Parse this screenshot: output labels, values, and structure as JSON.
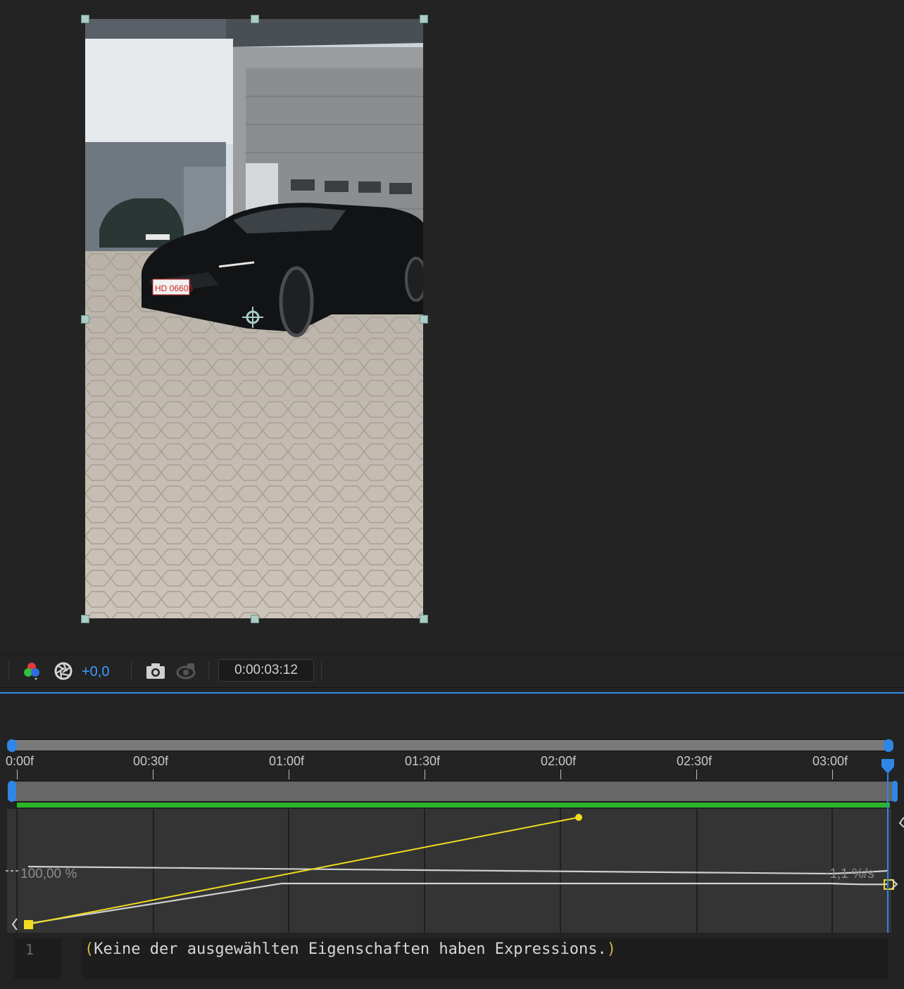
{
  "viewer": {
    "footage_description_icon": "photo-of-black-camaro-in-front-of-garage",
    "license_plate_front": "HD 06605",
    "selection_handle_color": "#a9cdc4"
  },
  "toolbar": {
    "color_channels_icon": "rgb-channels-icon",
    "exposure_icon": "exposure-aperture-icon",
    "exposure_value": "+0,0",
    "snapshot_icon": "camera-icon",
    "show_snapshot_icon": "show-snapshot-icon",
    "timecode": "0:00:03:12",
    "accent_color": "#3b9cff"
  },
  "timeline": {
    "ruler_labels": [
      "0:00f",
      "00:30f",
      "01:00f",
      "01:30f",
      "02:00f",
      "02:30f",
      "03:00f"
    ],
    "render_bar_color": "#2ab52a",
    "playhead_color": "#2f86e6"
  },
  "graph": {
    "value_label": "100,00 %",
    "speed_label": "-1,1 %/s",
    "value_curve_color": "#f0dc20",
    "speed_curve_color": "#d0d0d0"
  },
  "expression": {
    "line_number": "1",
    "open_paren": "(",
    "text": "Keine der ausgewählten Eigenschaften haben Expressions.",
    "close_paren": ")"
  }
}
